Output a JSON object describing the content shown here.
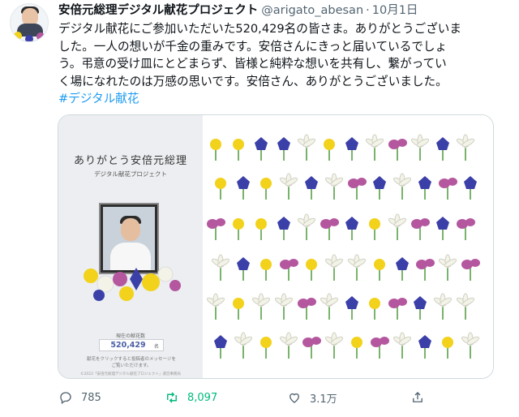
{
  "tweet": {
    "display_name": "安倍元総理デジタル献花プロジェクト",
    "handle": "@arigato_abesan",
    "separator": "·",
    "date": "10月1日",
    "lines": [
      "デジタル献花にご参加いただいた520,429名の皆さま。ありがとうございま",
      "した。一人の想いが千金の重みです。安倍さんにきっと届いているでしょ",
      "う。弔意の受け皿にとどまらず、皆様と純粋な想いを共有し、繋がってい",
      "く場になれたのは万感の思いです。安倍さん、ありがとうございました。"
    ],
    "hashtag": "#デジタル献花"
  },
  "card": {
    "title": "ありがとう安倍元総理",
    "subtitle": "デジタル献花プロジェクト",
    "counter_label": "現在の献花数",
    "counter_value": "520,429",
    "counter_unit": "名",
    "note_line1": "献花をクリックすると投稿者のメッセージを",
    "note_line2": "ご覧いただけます。",
    "copyright": "©2022「安倍元総理デジタル献花プロジェクト」運営事務局"
  },
  "actions": {
    "reply_count": "785",
    "retweet_count": "8,097",
    "like_count": "3.1万"
  },
  "colors": {
    "link": "#1d9bf0",
    "retweet": "#00ba7c",
    "muted": "#536471",
    "flower_yellow": "#f2d21b",
    "flower_blue": "#3b3fa8",
    "flower_pink": "#b4579f",
    "flower_white": "#f4f3e8"
  },
  "icons": [
    "reply-icon",
    "retweet-icon",
    "like-icon",
    "share-icon"
  ]
}
